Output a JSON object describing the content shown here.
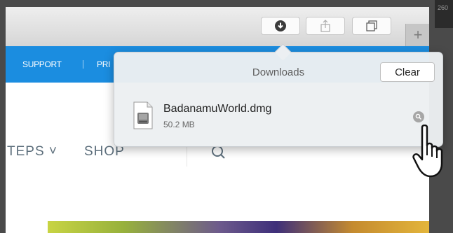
{
  "toolbar": {
    "downloads_icon": "download-arrow-circle",
    "share_icon": "share-box-arrow",
    "tabs_icon": "overlapping-squares",
    "new_tab_label": "+"
  },
  "corner_text": "260",
  "navbar": {
    "links": [
      "SUPPORT",
      "PRI"
    ]
  },
  "page_menu": {
    "items": [
      "TEPS ˅",
      "SHOP"
    ],
    "search_icon": "magnifier"
  },
  "downloads": {
    "title": "Downloads",
    "clear_label": "Clear",
    "items": [
      {
        "name": "BadanamuWorld.dmg",
        "size": "50.2 MB",
        "icon": "disk-image-file"
      }
    ]
  },
  "colors": {
    "navbar": "#1b8de0",
    "popover_bg": "#eceff2",
    "toolbar_bg": "#dcdcdc"
  }
}
